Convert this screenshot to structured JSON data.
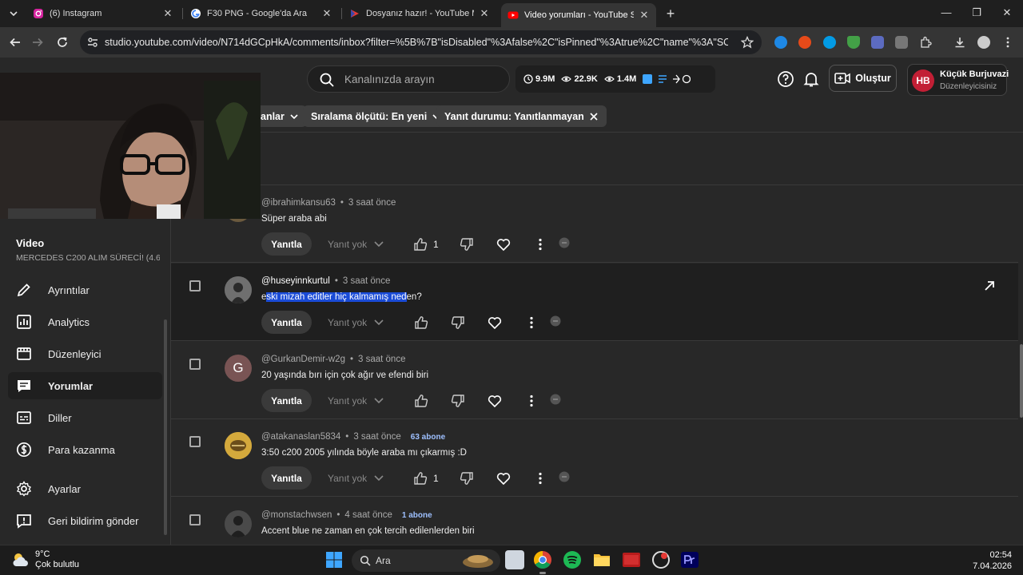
{
  "browser": {
    "tabs": [
      {
        "title": "(6) Instagram",
        "icon": "instagram-icon"
      },
      {
        "title": "F30 PNG - Google'da Ara",
        "icon": "google-icon"
      },
      {
        "title": "Dosyanız hazır! - YouTube MP3",
        "icon": "converter-icon"
      },
      {
        "title": "Video yorumları - YouTube Studio",
        "icon": "youtube-icon",
        "active": true
      }
    ],
    "url": "studio.youtube.com/video/N714dGCpHkA/comments/inbox?filter=%5B%7B\"isDisabled\"%3Afalse%2C\"isPinned\"%3Atrue%2C\"name\"%3A\"SORT_BY\"%2..."
  },
  "studio": {
    "search_placeholder": "Kanalınızda arayın",
    "stats": {
      "subscribers": "9.9M",
      "views": "22.9K",
      "views_total": "1.4M"
    },
    "create_label": "Oluştur",
    "channel": {
      "initials": "HB",
      "name": "Küçük Burjuvazi",
      "role": "Düzenleyicisiniz"
    }
  },
  "sidebar": {
    "section_label": "Video",
    "video_title": "MERCEDES C200 ALIM SÜRECİ! (4.6...",
    "items": [
      {
        "label": "Ayrıntılar",
        "icon": "pencil-icon"
      },
      {
        "label": "Analytics",
        "icon": "analytics-icon"
      },
      {
        "label": "Düzenleyici",
        "icon": "editor-icon"
      },
      {
        "label": "Yorumlar",
        "icon": "comments-icon",
        "active": true
      },
      {
        "label": "Diller",
        "icon": "subtitles-icon"
      },
      {
        "label": "Para kazanma",
        "icon": "dollar-icon"
      }
    ],
    "footer": [
      {
        "label": "Ayarlar",
        "icon": "gear-icon"
      },
      {
        "label": "Geri bildirim gönder",
        "icon": "feedback-icon"
      }
    ]
  },
  "filters": {
    "partial_chip": "anlar",
    "sort_chip": "Sıralama ölçütü: En yeni",
    "reply_chip": "Yanıt durumu: Yanıtlanmayan"
  },
  "comments": [
    {
      "author": "@ibrahimkansu63",
      "time": "3 saat önce",
      "text": "Süper araba abi",
      "likes": "1",
      "badge": ""
    },
    {
      "author": "@huseyinnkurtul",
      "time": "3 saat önce",
      "text_pre": "e",
      "text_hl": "ski mizah editler hiç kalmamış ned",
      "text_post": "en?",
      "likes": "",
      "badge": ""
    },
    {
      "author": "@GurkanDemir-w2g",
      "time": "3 saat önce",
      "text": "20 yaşında bırı için çok ağır ve efendi biri",
      "likes": "",
      "badge": "",
      "initial": "G"
    },
    {
      "author": "@atakanaslan5834",
      "time": "3 saat önce",
      "text": "3:50  c200  2005 yılında  böyle araba mı çıkarmış :D",
      "likes": "1",
      "badge": "63 abone"
    },
    {
      "author": "@monstachwsen",
      "time": "4 saat önce",
      "text": "Accent blue ne zaman en çok tercih edilenlerden biri",
      "likes": "",
      "badge": "1 abone"
    }
  ],
  "labels": {
    "reply": "Yanıtla",
    "no_reply": "Yanıt yok",
    "dot": "•"
  },
  "taskbar": {
    "temp": "9°C",
    "weather": "Çok bulutlu",
    "search": "Ara",
    "time": "02:54",
    "date": "7.04.2026"
  },
  "colors": {
    "accent": "#3ea6ff",
    "highlight": "#1a4bd6",
    "brand_red": "#ff0000"
  }
}
